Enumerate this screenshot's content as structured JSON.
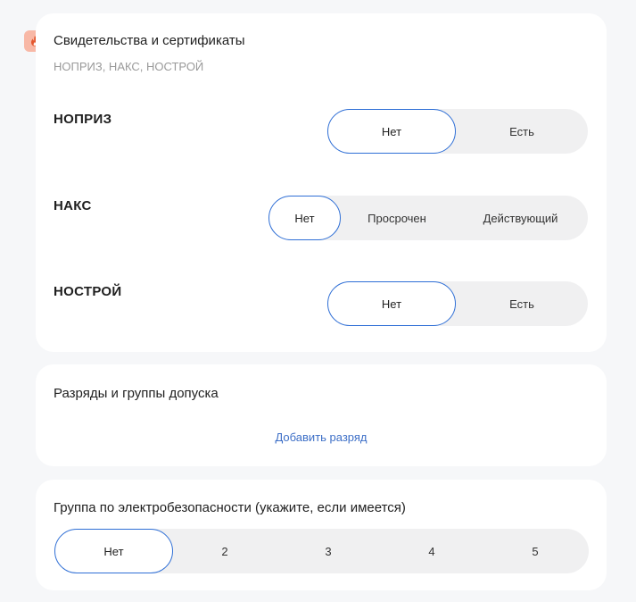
{
  "certificates": {
    "title": "Свидетельства и сертификаты",
    "subtitle": "НОПРИЗ, НАКС, НОСТРОЙ",
    "icon": "fire-icon",
    "rows": [
      {
        "label": "НОПРИЗ",
        "options": [
          "Нет",
          "Есть"
        ],
        "selected": "Нет"
      },
      {
        "label": "НАКС",
        "options": [
          "Нет",
          "Просрочен",
          "Действующий"
        ],
        "selected": "Нет"
      },
      {
        "label": "НОСТРОЙ",
        "options": [
          "Нет",
          "Есть"
        ],
        "selected": "Нет"
      }
    ]
  },
  "grades": {
    "title": "Разряды и группы допуска",
    "add_link": "Добавить разряд"
  },
  "electrical": {
    "title": "Группа по электробезопасности (укажите, если имеется)",
    "options": [
      "Нет",
      "2",
      "3",
      "4",
      "5"
    ],
    "selected": "Нет"
  },
  "colors": {
    "accent": "#2f6fd6",
    "link": "#3d6fc7",
    "badge": "#f8b8a6",
    "fire": "#e4572e"
  }
}
